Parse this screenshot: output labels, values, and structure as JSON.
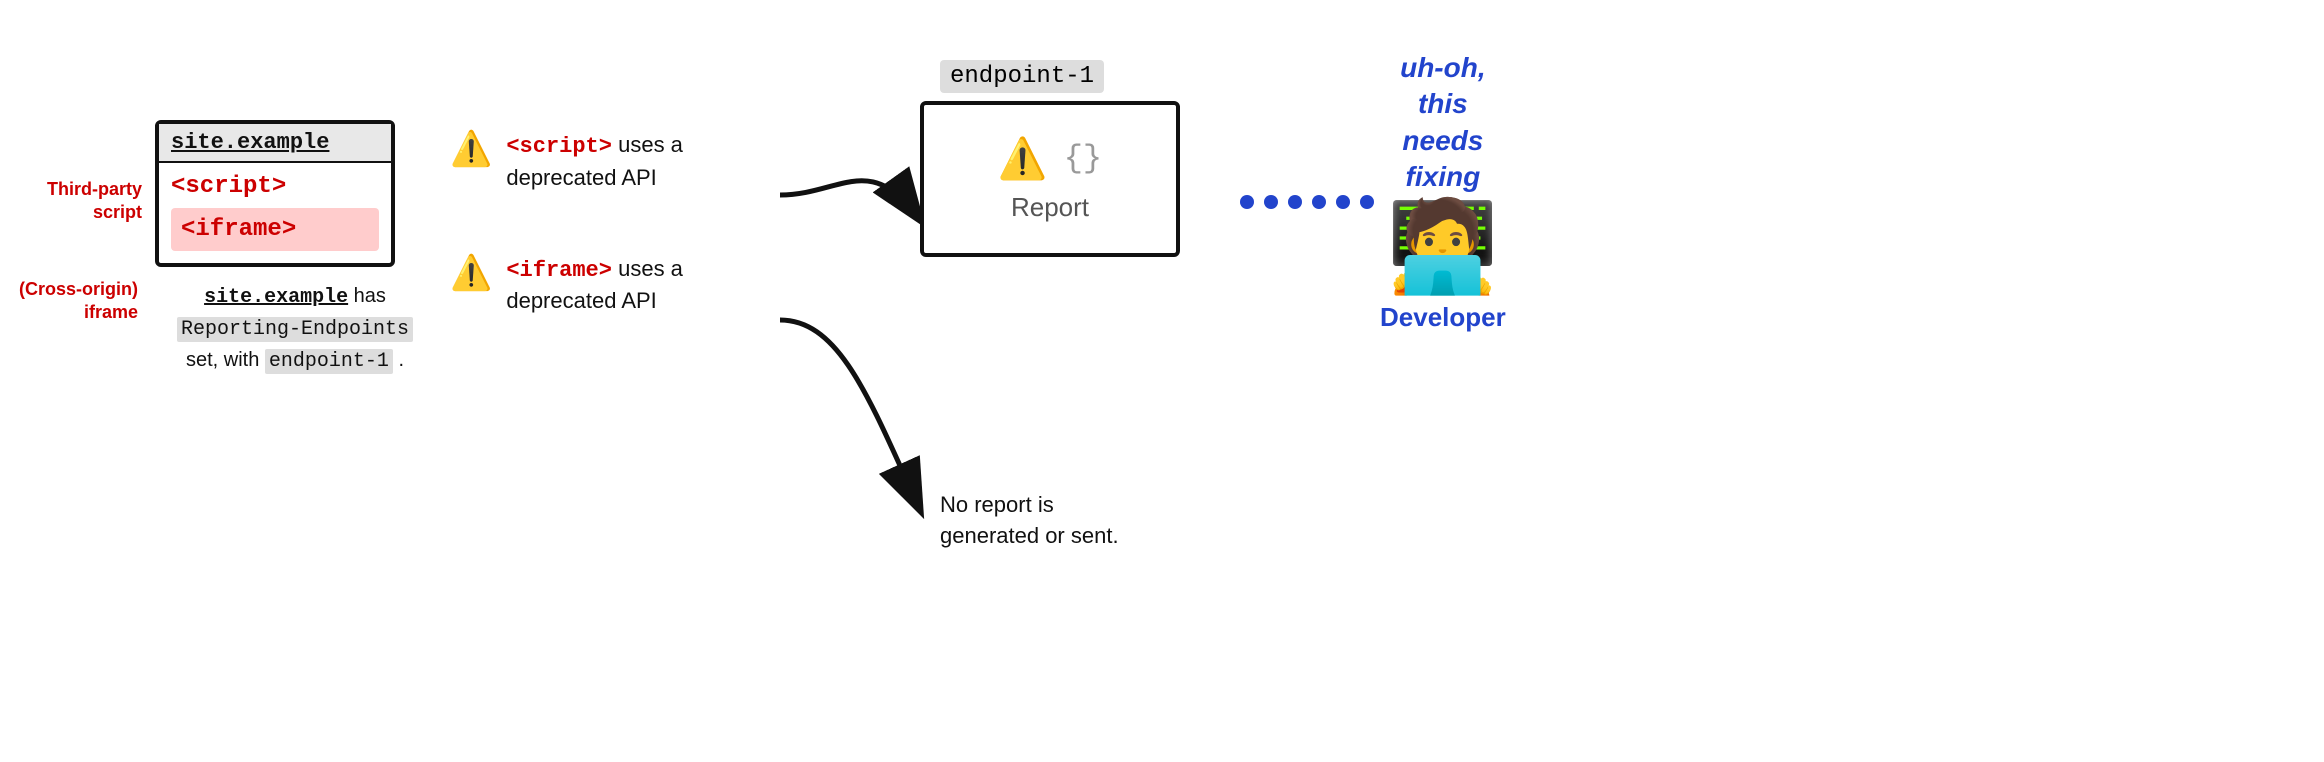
{
  "site": {
    "title": "site.example",
    "script_tag": "<script>",
    "iframe_tag": "<iframe>",
    "caption_line1": "site.example has",
    "caption_code1": "Reporting-Endpoints",
    "caption_line2": "set, with",
    "caption_code2": "endpoint-1",
    "caption_line3": "."
  },
  "side_labels": {
    "script": "Third-party script",
    "iframe": "(Cross-origin) iframe"
  },
  "warnings": [
    {
      "icon": "⚠️",
      "text_prefix": "",
      "code": "<script>",
      "text_suffix": " uses a deprecated API"
    },
    {
      "icon": "⚠️",
      "text_prefix": "",
      "code": "<iframe>",
      "text_suffix": " uses a deprecated API"
    }
  ],
  "endpoint": {
    "label": "endpoint-1",
    "report_text": "Report"
  },
  "no_report": {
    "line1": "No report is",
    "line2": "generated or sent."
  },
  "developer": {
    "uh_oh": "uh-oh,\nthis\nneeds\nfixing",
    "label": "Developer"
  },
  "icons": {
    "warning": "⚠️",
    "braces": "{}",
    "dots": "......"
  }
}
